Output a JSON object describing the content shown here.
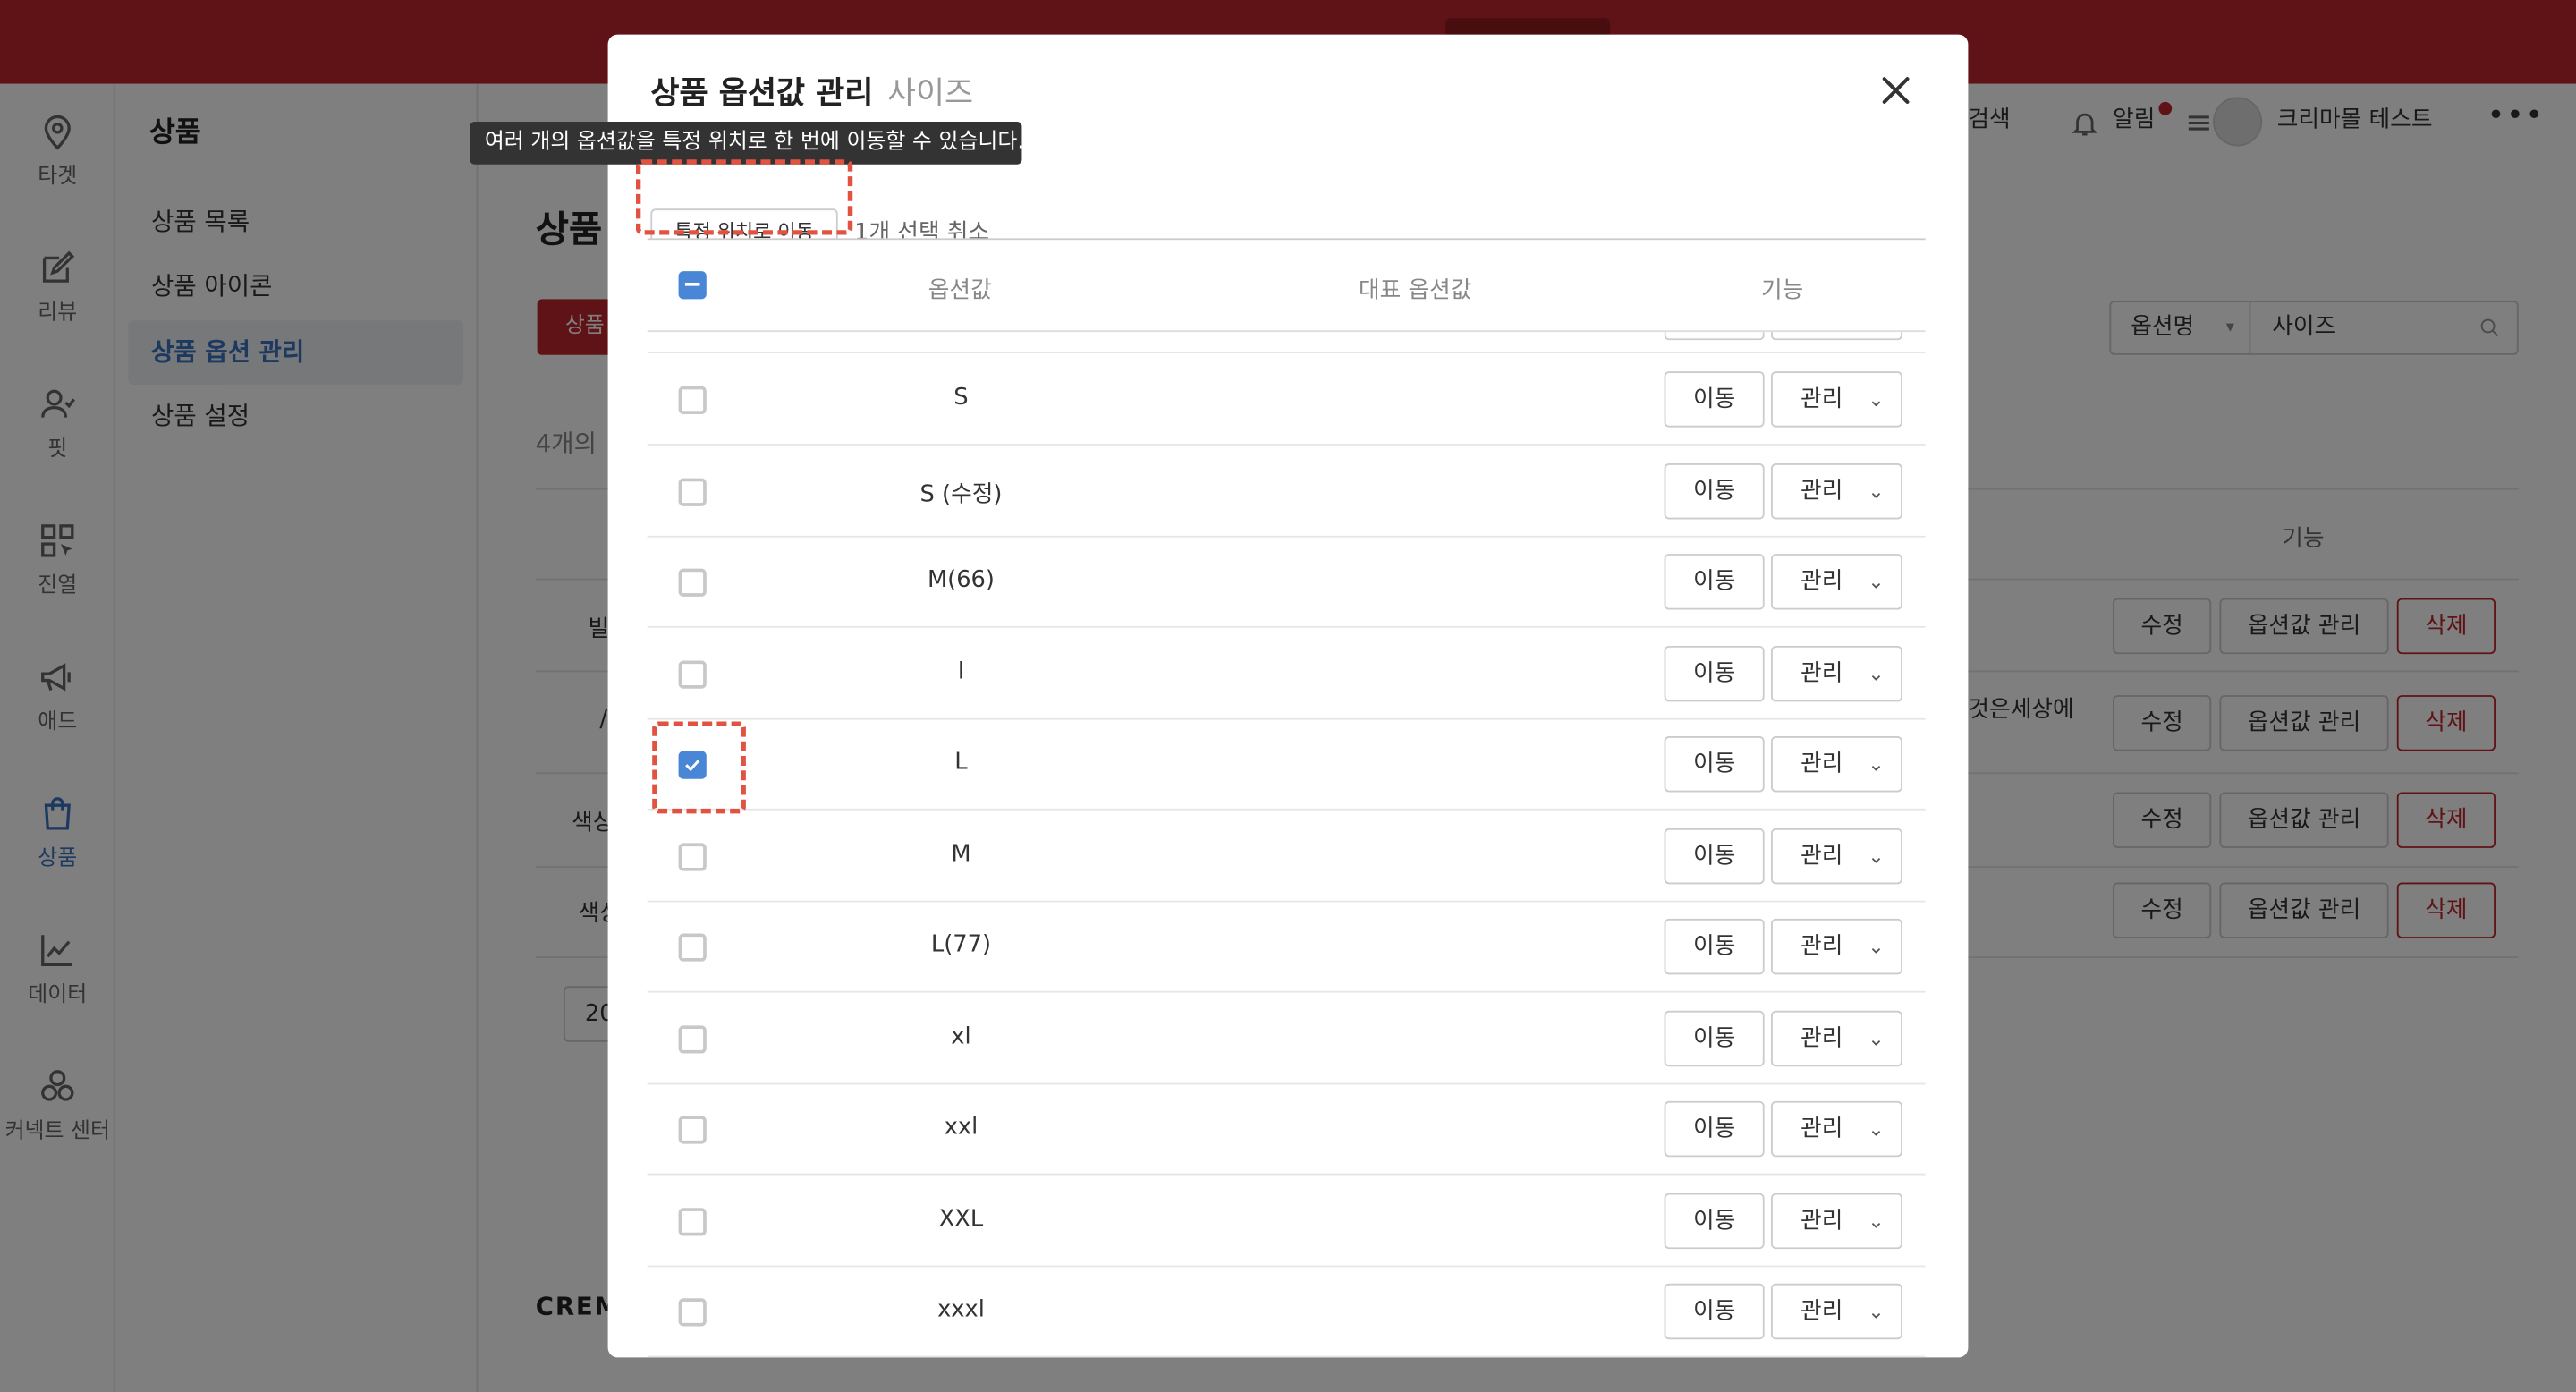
{
  "sidebar": {
    "items": [
      {
        "label": "타겟",
        "icon": "location-pin-icon",
        "active": false
      },
      {
        "label": "리뷰",
        "icon": "edit-icon",
        "active": false
      },
      {
        "label": "핏",
        "icon": "person-check-icon",
        "active": false
      },
      {
        "label": "진열",
        "icon": "grid-cursor-icon",
        "active": false
      },
      {
        "label": "애드",
        "icon": "megaphone-icon",
        "active": false
      },
      {
        "label": "상품",
        "icon": "shopping-bag-icon",
        "active": true
      },
      {
        "label": "데이터",
        "icon": "line-chart-icon",
        "active": false
      },
      {
        "label": "커넥트 센터",
        "icon": "connect-circles-icon",
        "active": false
      }
    ]
  },
  "subnav": {
    "title": "상품",
    "items": [
      "상품 목록",
      "상품 아이콘",
      "상품 옵션 관리",
      "상품 설정"
    ],
    "active_index": 2
  },
  "header": {
    "search": "검색",
    "notifications": "알림",
    "user": "크리마몰 테스트"
  },
  "page": {
    "title": "상품",
    "primary_button": "상품",
    "count_text": "4개의",
    "search_field": "옵션명",
    "search_value": "사이즈",
    "col_feature": "기능",
    "row_texts": [
      "빌",
      "/",
      "색상",
      "색상"
    ],
    "row_extra": "것은세상에",
    "row_buttons": {
      "edit": "수정",
      "option_values": "옵션값 관리",
      "delete": "삭제"
    },
    "pager_value": "20",
    "footer_logo": "CREM"
  },
  "modal": {
    "title": "상품 옵션값 관리",
    "subtitle": "사이즈",
    "tooltip": "여러 개의 옵션값을 특정 위치로 한 번에 이동할 수 있습니다.",
    "move_button": "특정 위치로 이동",
    "cancel_selection": "1개 선택 취소",
    "columns": {
      "value": "옵션값",
      "representative": "대표 옵션값",
      "feature": "기능"
    },
    "row_move": "이동",
    "row_manage": "관리",
    "rows": [
      {
        "value": "S",
        "checked": false
      },
      {
        "value": "S (수정)",
        "checked": false
      },
      {
        "value": "M(66)",
        "checked": false
      },
      {
        "value": "l",
        "checked": false
      },
      {
        "value": "L",
        "checked": true
      },
      {
        "value": "M",
        "checked": false
      },
      {
        "value": "L(77)",
        "checked": false
      },
      {
        "value": "xl",
        "checked": false
      },
      {
        "value": "xxl",
        "checked": false
      },
      {
        "value": "XXL",
        "checked": false
      },
      {
        "value": "xxxl",
        "checked": false
      }
    ]
  },
  "colors": {
    "brand_red": "#c1272d",
    "accent_blue": "#4a86d6",
    "highlight_dash": "#e15241"
  }
}
